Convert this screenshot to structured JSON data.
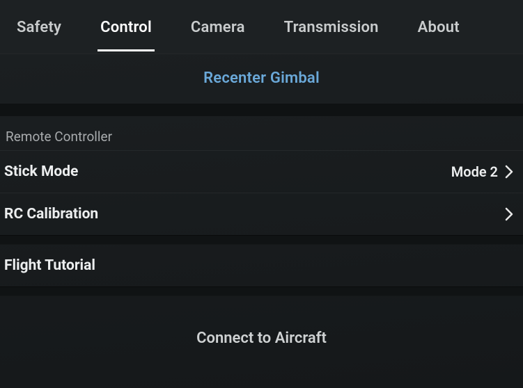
{
  "tabs": {
    "safety": "Safety",
    "control": "Control",
    "camera": "Camera",
    "transmission": "Transmission",
    "about": "About",
    "active": "control"
  },
  "recenter_gimbal_label": "Recenter Gimbal",
  "section_remote_controller": "Remote Controller",
  "rows": {
    "stick_mode": {
      "label": "Stick Mode",
      "value": "Mode 2"
    },
    "rc_calibration": {
      "label": "RC Calibration"
    },
    "flight_tutorial": {
      "label": "Flight Tutorial"
    }
  },
  "connect_label": "Connect to Aircraft",
  "colors": {
    "accent_link": "#6aa8d8",
    "bg": "#1a1d1f",
    "text": "#e8e8e8"
  }
}
